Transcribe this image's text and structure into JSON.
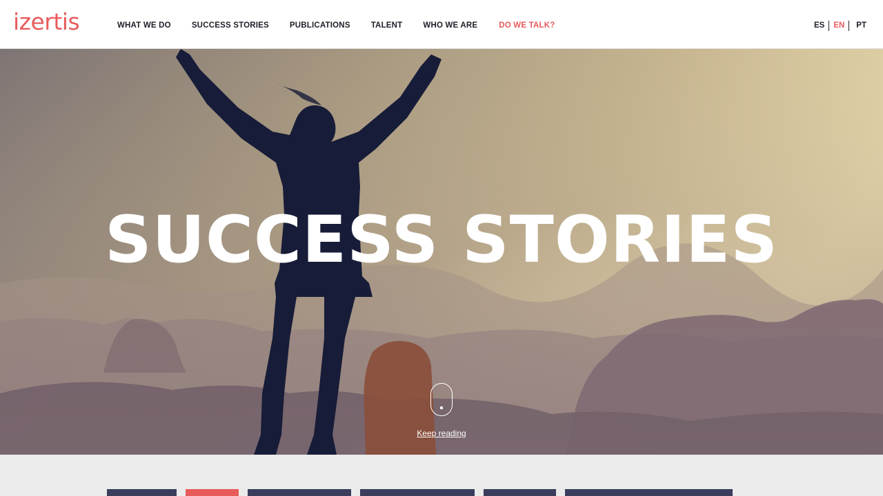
{
  "header": {
    "logo_text": "izertis",
    "nav": [
      {
        "label": "WHAT WE DO"
      },
      {
        "label": "SUCCESS STORIES"
      },
      {
        "label": "PUBLICATIONS"
      },
      {
        "label": "TALENT"
      },
      {
        "label": "WHO WE ARE"
      },
      {
        "label": "DO WE TALK?"
      }
    ],
    "languages": [
      {
        "label": "ES"
      },
      {
        "label": "EN",
        "active": true
      },
      {
        "label": "PT"
      }
    ]
  },
  "hero": {
    "title": "SUCCESS STORIES",
    "keep_reading": "Keep reading"
  },
  "colors": {
    "accent": "#e85b5b",
    "dark_navy": "#3a3d5c",
    "text_dark": "#1e1e28"
  },
  "filters": {
    "active_index": 1,
    "count": 6
  }
}
